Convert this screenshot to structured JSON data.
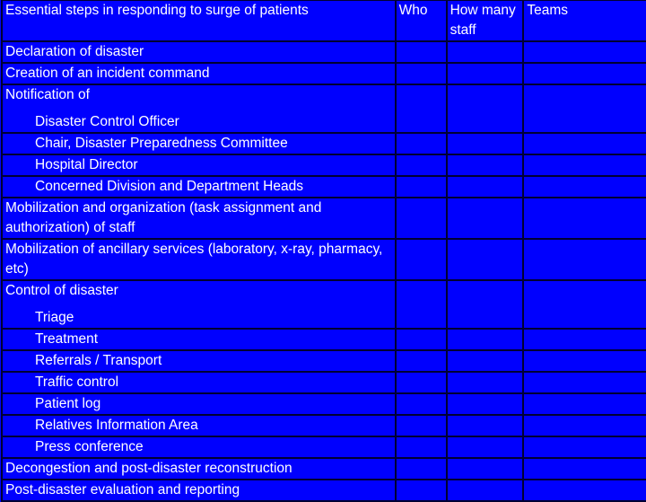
{
  "table": {
    "headers": [
      "Essential steps in responding to surge of patients",
      "Who",
      "How many staff",
      "Teams"
    ],
    "rows": {
      "declaration": "Declaration of disaster",
      "incident_command": "Creation of an incident command",
      "notification": "Notification of",
      "notification_items": [
        "Disaster Control Officer",
        "Chair, Disaster Preparedness Committee",
        "Hospital Director",
        "Concerned Division and Department Heads"
      ],
      "mobilization_staff": "Mobilization and organization (task assignment and authorization) of staff",
      "mobilization_ancillary": "Mobilization of ancillary services (laboratory, x-ray, pharmacy, etc)",
      "control": "Control of disaster",
      "control_items": [
        "Triage",
        "Treatment",
        "Referrals / Transport",
        "Traffic control",
        "Patient log",
        "Relatives Information Area",
        "Press conference"
      ],
      "decongestion": "Decongestion and post-disaster reconstruction",
      "evaluation": "Post-disaster evaluation and reporting"
    }
  },
  "colors": {
    "background": "#0000fe",
    "text": "#ffffff",
    "grid": "#000033"
  }
}
